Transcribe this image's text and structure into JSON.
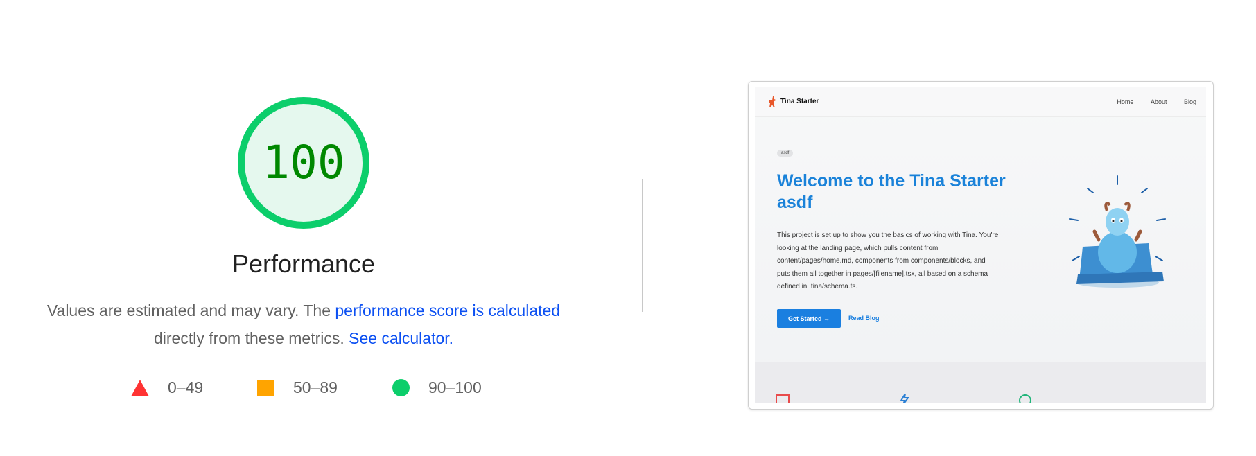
{
  "score": {
    "value": "100",
    "fraction": 1.0,
    "title": "Performance",
    "ring_color": "#0cce6b",
    "text_color": "#008800",
    "fill_color": "#e5f8ee"
  },
  "description": {
    "text1": "Values are estimated and may vary. The",
    "link1": "performance score is calculated",
    "text2": "directly from these metrics.",
    "link2": "See calculator."
  },
  "legend": [
    {
      "shape": "triangle",
      "range": "0–49",
      "color": "#ff3333"
    },
    {
      "shape": "square",
      "range": "50–89",
      "color": "#ffa400"
    },
    {
      "shape": "circle",
      "range": "90–100",
      "color": "#0cce6b"
    }
  ],
  "screenshot": {
    "brand": "Tina Starter",
    "nav": [
      "Home",
      "About",
      "Blog"
    ],
    "badge": "asdf",
    "hero_title": "Welcome to the Tina Starter asdf",
    "hero_text": "This project is set up to show you the basics of working with Tina. You're looking at the landing page, which pulls content from content/pages/home.md, components from components/blocks, and puts them all together in pages/[filename].tsx, all based on a schema defined in .tina/schema.ts.",
    "primary_button": "Get Started →",
    "secondary_button": "Read Blog"
  }
}
